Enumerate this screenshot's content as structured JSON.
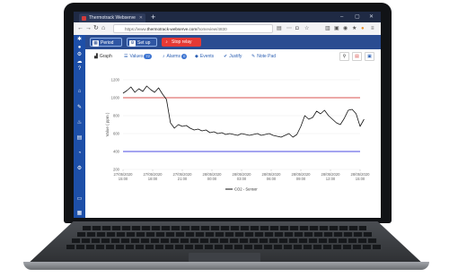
{
  "browser": {
    "tab_title": "Thermotrack Webserve",
    "url_prefix": "https://www.",
    "url_host": "thermotrack-webserve.com",
    "url_path": "/homeview/4830"
  },
  "app": {
    "buttons": {
      "period": "Period",
      "setup": "Set up",
      "stop_relay": "Stop relay"
    },
    "tabs": {
      "graph": "Graph",
      "values": "Values",
      "values_count": "72",
      "alarms": "Alarms",
      "alarms_count": "0",
      "events": "Events",
      "justify": "Justify",
      "note_pad": "Note Pad"
    }
  },
  "colors": {
    "sidebar": "#1d4fa8",
    "toolbar": "#2a4c91",
    "stop_relay": "#e53935",
    "upper_threshold": "#d9534f",
    "lower_threshold": "#4a4ae0",
    "series": "#111111"
  },
  "chart_data": {
    "type": "line",
    "ylabel": "Value ( ppm )",
    "ylim": [
      200,
      1200
    ],
    "yticks": [
      "1200",
      "1000",
      "800",
      "600",
      "400",
      "200"
    ],
    "xticks": [
      [
        "27/05/2020",
        "15:00"
      ],
      [
        "27/05/2020",
        "18:00"
      ],
      [
        "27/05/2020",
        "21:00"
      ],
      [
        "28/05/2020",
        "00:00"
      ],
      [
        "28/05/2020",
        "03:00"
      ],
      [
        "28/05/2020",
        "06:00"
      ],
      [
        "28/05/2020",
        "09:00"
      ],
      [
        "28/05/2020",
        "12:00"
      ],
      [
        "28/05/2020",
        "15:00"
      ]
    ],
    "thresholds": [
      {
        "value": 1000,
        "color": "#d9534f"
      },
      {
        "value": 400,
        "color": "#4a4ae0"
      }
    ],
    "series": [
      {
        "name": "CO2 - Sensor",
        "x": [
          0,
          0.4,
          0.8,
          1.2,
          1.6,
          2.0,
          2.4,
          2.8,
          3.2,
          3.6,
          4.0,
          4.4,
          4.8,
          5.2,
          5.6,
          6.0,
          6.4,
          6.8,
          7.2,
          7.6,
          8.0,
          8.4,
          8.8,
          9.2,
          9.6,
          10.0,
          10.4,
          10.8,
          11.2,
          11.6,
          12.0,
          12.4,
          12.8,
          13.2,
          13.6,
          14.0,
          14.4,
          14.8,
          15.2,
          15.6,
          16.0,
          16.4,
          16.8,
          17.2,
          17.6,
          18.0,
          18.4,
          18.8,
          19.2,
          19.6,
          20.0,
          20.4,
          20.8,
          21.2,
          21.6,
          22.0,
          22.4,
          22.8,
          23.2,
          23.6,
          24.0,
          24.4
        ],
        "y": [
          1050,
          1080,
          1120,
          1060,
          1100,
          1070,
          1130,
          1090,
          1060,
          1110,
          1040,
          980,
          720,
          660,
          700,
          680,
          690,
          660,
          640,
          650,
          630,
          640,
          610,
          620,
          600,
          610,
          590,
          600,
          590,
          580,
          600,
          590,
          580,
          590,
          600,
          580,
          590,
          600,
          580,
          570,
          560,
          580,
          600,
          560,
          590,
          680,
          800,
          760,
          780,
          850,
          820,
          860,
          800,
          760,
          720,
          700,
          770,
          860,
          870,
          820,
          680,
          760
        ]
      }
    ]
  }
}
